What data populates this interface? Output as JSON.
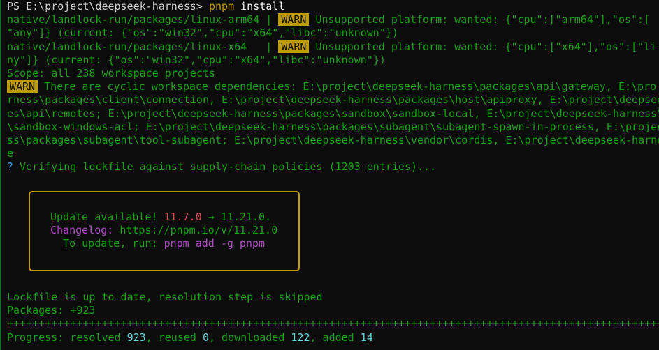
{
  "prompt": {
    "ps": "PS E:\\project\\deepseek-harness>",
    "command": "pnpm",
    "args": " install"
  },
  "warnings": [
    {
      "pkg": "native/landlock-run/packages/linux-arm64",
      "sep": " | ",
      "badge": "WARN",
      "msg": " Unsupported platform: wanted: {\"cpu\":[\"arm64\"],\"os\":[",
      "cont": "\"any\"]} (current: {\"os\":\"win32\",\"cpu\":\"x64\",\"libc\":\"unknown\"})"
    },
    {
      "pkg": "native/landlock-run/packages/linux-x64",
      "sep": "   | ",
      "badge": "WARN",
      "msg": " Unsupported platform: wanted: {\"cpu\":[\"x64\"],\"os\":[\"li",
      "cont": "ny\"]} (current: {\"os\":\"win32\",\"cpu\":\"x64\",\"libc\":\"unknown\"})"
    }
  ],
  "scope": "Scope: all 238 workspace projects",
  "cyclic": {
    "badge": "WARN",
    "lines": [
      " There are cyclic workspace dependencies: E:\\project\\deepseek-harness\\packages\\api\\gateway, E:\\pro",
      "rness\\packages\\client\\connection, E:\\project\\deepseek-harness\\packages\\host\\apiproxy, E:\\project\\deepsee",
      "es\\api\\remotes; E:\\project\\deepseek-harness\\packages\\sandbox\\sandbox-local, E:\\project\\deepseek-harness\\",
      "\\sandbox-windows-acl; E:\\project\\deepseek-harness\\packages\\subagent\\subagent-spawn-in-process, E:\\projec",
      "ss\\packages\\subagent\\tool-subagent; E:\\project\\deepseek-harness\\vendor\\cordis, E:\\project\\deepseek-harne",
      "e"
    ]
  },
  "verifying": {
    "mark": "?",
    "text": " Verifying lockfile against supply-chain policies (1203 entries)..."
  },
  "update_box": {
    "line1_prefix": "Update available! ",
    "old_version": "11.7.0",
    "arrow": " → ",
    "new_version": "11.21.0.",
    "changelog_label": "Changelog:",
    "changelog_url": " https://pnpm.io/v/11.21.0",
    "update_prefix": "  To update, run: ",
    "update_cmd": "pnpm add -g pnpm"
  },
  "lockfile_status": "Lockfile is up to date, resolution step is skipped",
  "packages": "Packages: +923",
  "plus_bar": "++++++++++++++++++++++++++++++++++++++++++++++++++++++++++++++++++++++++++++++++++++++++++++++++++++++++++++++++",
  "progress": {
    "label": "Progress: resolved ",
    "resolved": "923",
    "reused_label": ", reused ",
    "reused": "0",
    "downloaded_label": ", downloaded ",
    "downloaded": "122",
    "added_label": ", added ",
    "added": "14"
  },
  "colors": {
    "background": "#0c0c0c",
    "green": "#13a10e",
    "warn_badge": "#c19c00",
    "red": "#e74856",
    "magenta": "#b148c6",
    "cyan": "#61d6d6"
  }
}
